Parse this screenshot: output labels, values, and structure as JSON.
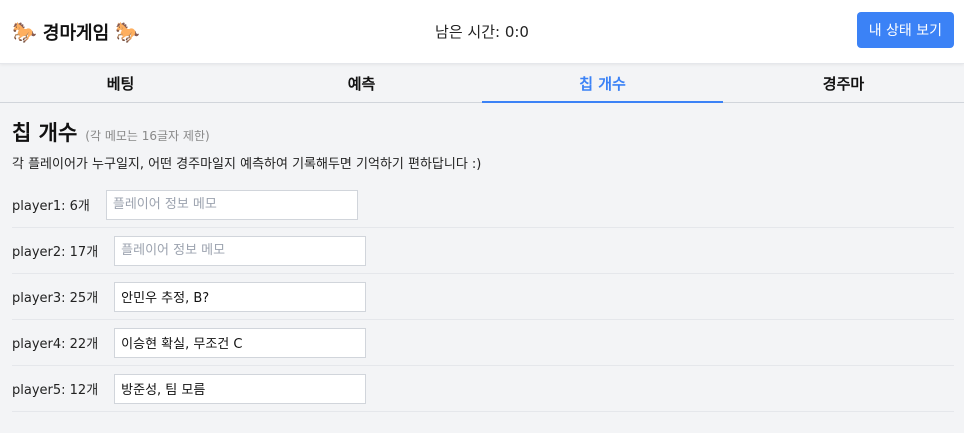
{
  "header": {
    "title": "경마게임",
    "horse_left": "🐎",
    "horse_right": "🐎",
    "timer_label": "남은 시간: 0:0",
    "status_button": "내 상태 보기"
  },
  "tabs": [
    {
      "label": "베팅",
      "active": false
    },
    {
      "label": "예측",
      "active": false
    },
    {
      "label": "칩 개수",
      "active": true
    },
    {
      "label": "경주마",
      "active": false
    }
  ],
  "section": {
    "title": "칩 개수",
    "note": "(각 메모는 16글자 제한)",
    "description": "각 플레이어가 누구일지, 어떤 경주마일지 예측하여 기록해두면 기억하기 편하답니다 :)"
  },
  "memo_placeholder": "플레이어 정보 메모",
  "players": [
    {
      "label": "player1: 6개",
      "memo": ""
    },
    {
      "label": "player2: 17개",
      "memo": ""
    },
    {
      "label": "player3: 25개",
      "memo": "안민우 추정, B?"
    },
    {
      "label": "player4: 22개",
      "memo": "이승현 확실, 무조건 C"
    },
    {
      "label": "player5: 12개",
      "memo": "방준성, 팀 모름"
    }
  ],
  "colors": {
    "accent": "#3b82f6"
  }
}
